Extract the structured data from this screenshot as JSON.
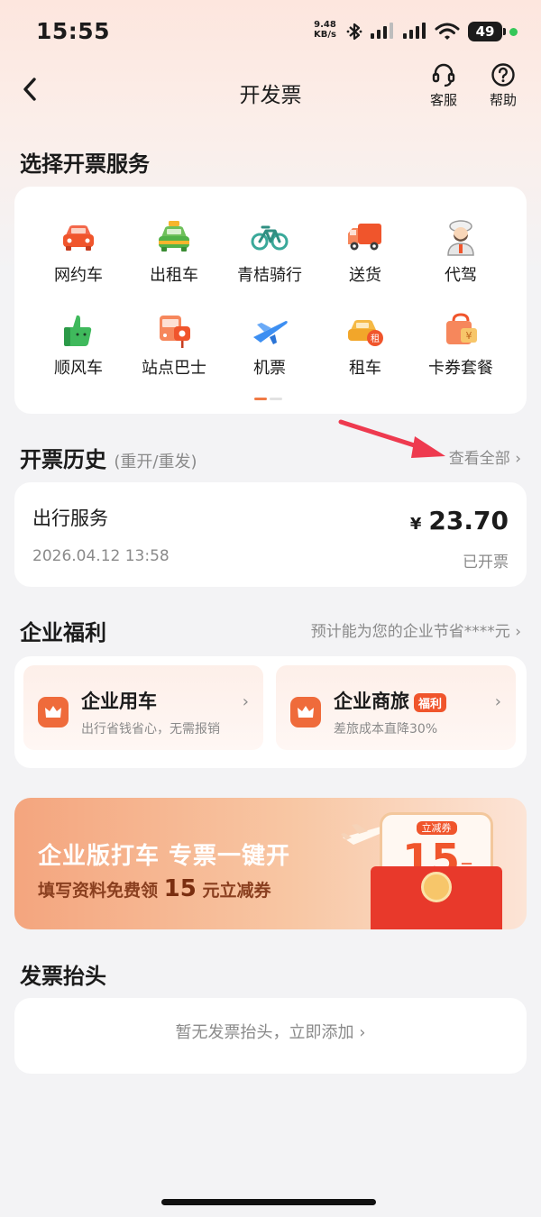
{
  "status_bar": {
    "time": "15:55",
    "net_speed_value": "9.48",
    "net_speed_unit": "KB/s",
    "battery": "49"
  },
  "nav": {
    "title": "开发票",
    "customer_service": "客服",
    "help": "帮助"
  },
  "services": {
    "title": "选择开票服务",
    "items": [
      {
        "label": "网约车",
        "icon": "car-icon"
      },
      {
        "label": "出租车",
        "icon": "taxi-icon"
      },
      {
        "label": "青桔骑行",
        "icon": "bike-icon"
      },
      {
        "label": "送货",
        "icon": "truck-icon"
      },
      {
        "label": "代驾",
        "icon": "driver-icon"
      },
      {
        "label": "顺风车",
        "icon": "thumbs-up-icon"
      },
      {
        "label": "站点巴士",
        "icon": "bus-icon"
      },
      {
        "label": "机票",
        "icon": "plane-icon"
      },
      {
        "label": "租车",
        "icon": "rental-car-icon"
      },
      {
        "label": "卡券套餐",
        "icon": "coupon-bag-icon"
      }
    ]
  },
  "history": {
    "title": "开票历史",
    "subtitle": "(重开/重发)",
    "view_all": "查看全部",
    "record": {
      "service": "出行服务",
      "currency": "¥",
      "amount": "23.70",
      "date": "2026.04.12 13:58",
      "status": "已开票"
    }
  },
  "benefits": {
    "title": "企业福利",
    "hint": "预计能为您的企业节省****元",
    "cards": [
      {
        "title": "企业用车",
        "desc": "出行省钱省心，无需报销"
      },
      {
        "title": "企业商旅",
        "tag": "福利",
        "desc": "差旅成本直降30%"
      }
    ]
  },
  "promo": {
    "headline": "企业版打车 专票一键开",
    "sub_prefix": "填写资料免费领",
    "sub_amount": "15",
    "sub_suffix": "元立减券",
    "coupon_label": "立减券",
    "coupon_amount": "15",
    "coupon_unit": "元"
  },
  "invoice_header": {
    "title": "发票抬头",
    "empty_text": "暂无发票抬头，立即添加"
  },
  "colors": {
    "accent": "#f07a45",
    "brand_red": "#f0552c",
    "annotation": "#ee3a4f"
  }
}
